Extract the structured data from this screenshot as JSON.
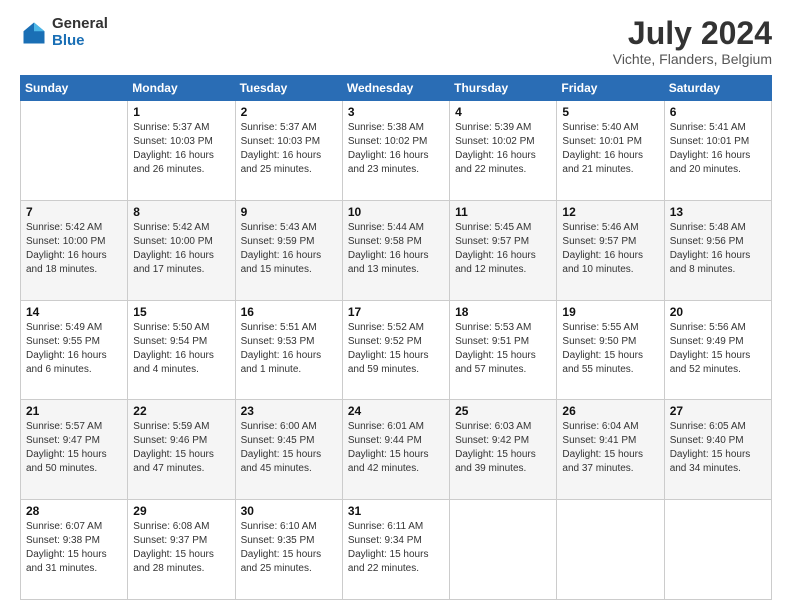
{
  "logo": {
    "general": "General",
    "blue": "Blue"
  },
  "title": "July 2024",
  "location": "Vichte, Flanders, Belgium",
  "days_of_week": [
    "Sunday",
    "Monday",
    "Tuesday",
    "Wednesday",
    "Thursday",
    "Friday",
    "Saturday"
  ],
  "weeks": [
    [
      {
        "day": "",
        "sunrise": "",
        "sunset": "",
        "daylight": ""
      },
      {
        "day": "1",
        "sunrise": "Sunrise: 5:37 AM",
        "sunset": "Sunset: 10:03 PM",
        "daylight": "Daylight: 16 hours and 26 minutes."
      },
      {
        "day": "2",
        "sunrise": "Sunrise: 5:37 AM",
        "sunset": "Sunset: 10:03 PM",
        "daylight": "Daylight: 16 hours and 25 minutes."
      },
      {
        "day": "3",
        "sunrise": "Sunrise: 5:38 AM",
        "sunset": "Sunset: 10:02 PM",
        "daylight": "Daylight: 16 hours and 23 minutes."
      },
      {
        "day": "4",
        "sunrise": "Sunrise: 5:39 AM",
        "sunset": "Sunset: 10:02 PM",
        "daylight": "Daylight: 16 hours and 22 minutes."
      },
      {
        "day": "5",
        "sunrise": "Sunrise: 5:40 AM",
        "sunset": "Sunset: 10:01 PM",
        "daylight": "Daylight: 16 hours and 21 minutes."
      },
      {
        "day": "6",
        "sunrise": "Sunrise: 5:41 AM",
        "sunset": "Sunset: 10:01 PM",
        "daylight": "Daylight: 16 hours and 20 minutes."
      }
    ],
    [
      {
        "day": "7",
        "sunrise": "Sunrise: 5:42 AM",
        "sunset": "Sunset: 10:00 PM",
        "daylight": "Daylight: 16 hours and 18 minutes."
      },
      {
        "day": "8",
        "sunrise": "Sunrise: 5:42 AM",
        "sunset": "Sunset: 10:00 PM",
        "daylight": "Daylight: 16 hours and 17 minutes."
      },
      {
        "day": "9",
        "sunrise": "Sunrise: 5:43 AM",
        "sunset": "Sunset: 9:59 PM",
        "daylight": "Daylight: 16 hours and 15 minutes."
      },
      {
        "day": "10",
        "sunrise": "Sunrise: 5:44 AM",
        "sunset": "Sunset: 9:58 PM",
        "daylight": "Daylight: 16 hours and 13 minutes."
      },
      {
        "day": "11",
        "sunrise": "Sunrise: 5:45 AM",
        "sunset": "Sunset: 9:57 PM",
        "daylight": "Daylight: 16 hours and 12 minutes."
      },
      {
        "day": "12",
        "sunrise": "Sunrise: 5:46 AM",
        "sunset": "Sunset: 9:57 PM",
        "daylight": "Daylight: 16 hours and 10 minutes."
      },
      {
        "day": "13",
        "sunrise": "Sunrise: 5:48 AM",
        "sunset": "Sunset: 9:56 PM",
        "daylight": "Daylight: 16 hours and 8 minutes."
      }
    ],
    [
      {
        "day": "14",
        "sunrise": "Sunrise: 5:49 AM",
        "sunset": "Sunset: 9:55 PM",
        "daylight": "Daylight: 16 hours and 6 minutes."
      },
      {
        "day": "15",
        "sunrise": "Sunrise: 5:50 AM",
        "sunset": "Sunset: 9:54 PM",
        "daylight": "Daylight: 16 hours and 4 minutes."
      },
      {
        "day": "16",
        "sunrise": "Sunrise: 5:51 AM",
        "sunset": "Sunset: 9:53 PM",
        "daylight": "Daylight: 16 hours and 1 minute."
      },
      {
        "day": "17",
        "sunrise": "Sunrise: 5:52 AM",
        "sunset": "Sunset: 9:52 PM",
        "daylight": "Daylight: 15 hours and 59 minutes."
      },
      {
        "day": "18",
        "sunrise": "Sunrise: 5:53 AM",
        "sunset": "Sunset: 9:51 PM",
        "daylight": "Daylight: 15 hours and 57 minutes."
      },
      {
        "day": "19",
        "sunrise": "Sunrise: 5:55 AM",
        "sunset": "Sunset: 9:50 PM",
        "daylight": "Daylight: 15 hours and 55 minutes."
      },
      {
        "day": "20",
        "sunrise": "Sunrise: 5:56 AM",
        "sunset": "Sunset: 9:49 PM",
        "daylight": "Daylight: 15 hours and 52 minutes."
      }
    ],
    [
      {
        "day": "21",
        "sunrise": "Sunrise: 5:57 AM",
        "sunset": "Sunset: 9:47 PM",
        "daylight": "Daylight: 15 hours and 50 minutes."
      },
      {
        "day": "22",
        "sunrise": "Sunrise: 5:59 AM",
        "sunset": "Sunset: 9:46 PM",
        "daylight": "Daylight: 15 hours and 47 minutes."
      },
      {
        "day": "23",
        "sunrise": "Sunrise: 6:00 AM",
        "sunset": "Sunset: 9:45 PM",
        "daylight": "Daylight: 15 hours and 45 minutes."
      },
      {
        "day": "24",
        "sunrise": "Sunrise: 6:01 AM",
        "sunset": "Sunset: 9:44 PM",
        "daylight": "Daylight: 15 hours and 42 minutes."
      },
      {
        "day": "25",
        "sunrise": "Sunrise: 6:03 AM",
        "sunset": "Sunset: 9:42 PM",
        "daylight": "Daylight: 15 hours and 39 minutes."
      },
      {
        "day": "26",
        "sunrise": "Sunrise: 6:04 AM",
        "sunset": "Sunset: 9:41 PM",
        "daylight": "Daylight: 15 hours and 37 minutes."
      },
      {
        "day": "27",
        "sunrise": "Sunrise: 6:05 AM",
        "sunset": "Sunset: 9:40 PM",
        "daylight": "Daylight: 15 hours and 34 minutes."
      }
    ],
    [
      {
        "day": "28",
        "sunrise": "Sunrise: 6:07 AM",
        "sunset": "Sunset: 9:38 PM",
        "daylight": "Daylight: 15 hours and 31 minutes."
      },
      {
        "day": "29",
        "sunrise": "Sunrise: 6:08 AM",
        "sunset": "Sunset: 9:37 PM",
        "daylight": "Daylight: 15 hours and 28 minutes."
      },
      {
        "day": "30",
        "sunrise": "Sunrise: 6:10 AM",
        "sunset": "Sunset: 9:35 PM",
        "daylight": "Daylight: 15 hours and 25 minutes."
      },
      {
        "day": "31",
        "sunrise": "Sunrise: 6:11 AM",
        "sunset": "Sunset: 9:34 PM",
        "daylight": "Daylight: 15 hours and 22 minutes."
      },
      {
        "day": "",
        "sunrise": "",
        "sunset": "",
        "daylight": ""
      },
      {
        "day": "",
        "sunrise": "",
        "sunset": "",
        "daylight": ""
      },
      {
        "day": "",
        "sunrise": "",
        "sunset": "",
        "daylight": ""
      }
    ]
  ]
}
